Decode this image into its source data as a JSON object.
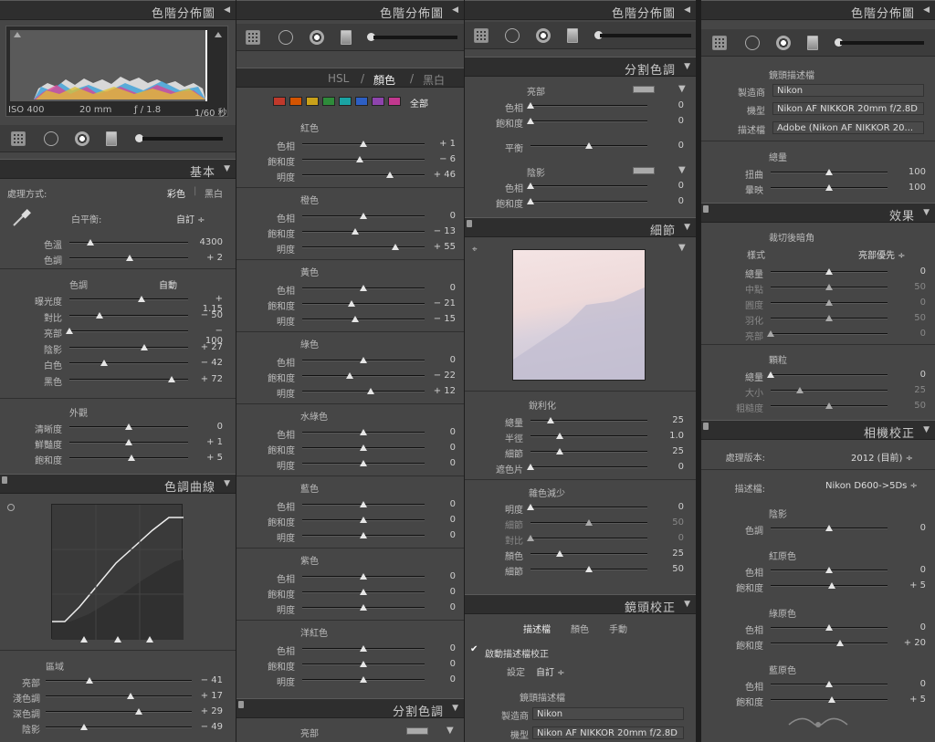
{
  "colors": {
    "panel": "#464646",
    "header": "#2e2e2e"
  },
  "c1": {
    "histogram_title": "色階分佈圖",
    "hist_info": {
      "iso": "ISO 400",
      "focal": "20 mm",
      "aperture": "ƒ / 1.8",
      "shutter": "1/60 秒"
    },
    "basic_title": "基本",
    "treatment_label": "處理方式:",
    "color_label": "彩色",
    "bw_label": "黑白",
    "wb_label": "白平衡:",
    "wb_value": "自訂 ÷",
    "temp": {
      "label": "色溫",
      "value": "4300",
      "pos": 0.18
    },
    "tint": {
      "label": "色調",
      "value": "+ 2",
      "pos": 0.51
    },
    "tone_label": "色調",
    "auto_label": "自動",
    "tone": [
      {
        "label": "曝光度",
        "value": "+ 1.15",
        "pos": 0.61
      },
      {
        "label": "對比",
        "value": "− 50",
        "pos": 0.25
      },
      {
        "label": "亮部",
        "value": "− 100",
        "pos": 0.0
      },
      {
        "label": "陰影",
        "value": "+ 27",
        "pos": 0.63
      },
      {
        "label": "白色",
        "value": "− 42",
        "pos": 0.29
      },
      {
        "label": "黑色",
        "value": "+ 72",
        "pos": 0.86
      }
    ],
    "presence_label": "外觀",
    "presence": [
      {
        "label": "清晰度",
        "value": "0",
        "pos": 0.5
      },
      {
        "label": "鮮豔度",
        "value": "+ 1",
        "pos": 0.5
      },
      {
        "label": "飽和度",
        "value": "+ 5",
        "pos": 0.52
      }
    ],
    "curve_title": "色調曲線",
    "region_label": "區域",
    "region": [
      {
        "label": "亮部",
        "value": "− 41",
        "pos": 0.3
      },
      {
        "label": "淺色調",
        "value": "+ 17",
        "pos": 0.58
      },
      {
        "label": "深色調",
        "value": "+ 29",
        "pos": 0.64
      },
      {
        "label": "陰影",
        "value": "− 49",
        "pos": 0.26
      }
    ]
  },
  "c2": {
    "histogram_title": "色階分佈圖",
    "hsl_tabs": {
      "hsl": "HSL",
      "slash1": "/",
      "color": "顏色",
      "slash2": "/",
      "bw": "黑白"
    },
    "all_label": "全部",
    "swatches": [
      "#c0392b",
      "#d35400",
      "#c9a11a",
      "#2e8b3a",
      "#1aa3a3",
      "#2d5fc4",
      "#8e44ad",
      "#c2388f"
    ],
    "groups": [
      {
        "name": "紅色",
        "rows": [
          {
            "label": "色相",
            "value": "+ 1",
            "pos": 0.5
          },
          {
            "label": "飽和度",
            "value": "− 6",
            "pos": 0.47
          },
          {
            "label": "明度",
            "value": "+ 46",
            "pos": 0.72
          }
        ],
        "grad": [
          "#c83c3c",
          "#d8a040"
        ]
      },
      {
        "name": "橙色",
        "rows": [
          {
            "label": "色相",
            "value": "0",
            "pos": 0.5
          },
          {
            "label": "飽和度",
            "value": "− 13",
            "pos": 0.43
          },
          {
            "label": "明度",
            "value": "+ 55",
            "pos": 0.76
          }
        ],
        "grad": [
          "#d0603a",
          "#d8c040"
        ]
      },
      {
        "name": "黃色",
        "rows": [
          {
            "label": "色相",
            "value": "0",
            "pos": 0.5
          },
          {
            "label": "飽和度",
            "value": "− 21",
            "pos": 0.4
          },
          {
            "label": "明度",
            "value": "− 15",
            "pos": 0.43
          }
        ],
        "grad": [
          "#d0a030",
          "#90c040"
        ]
      },
      {
        "name": "綠色",
        "rows": [
          {
            "label": "色相",
            "value": "0",
            "pos": 0.5
          },
          {
            "label": "飽和度",
            "value": "− 22",
            "pos": 0.39
          },
          {
            "label": "明度",
            "value": "+ 12",
            "pos": 0.56
          }
        ],
        "grad": [
          "#a0c040",
          "#30b080"
        ]
      },
      {
        "name": "水綠色",
        "rows": [
          {
            "label": "色相",
            "value": "0",
            "pos": 0.5
          },
          {
            "label": "飽和度",
            "value": "0",
            "pos": 0.5
          },
          {
            "label": "明度",
            "value": "0",
            "pos": 0.5
          }
        ],
        "grad": [
          "#30b080",
          "#3080c8"
        ]
      },
      {
        "name": "藍色",
        "rows": [
          {
            "label": "色相",
            "value": "0",
            "pos": 0.5
          },
          {
            "label": "飽和度",
            "value": "0",
            "pos": 0.5
          },
          {
            "label": "明度",
            "value": "0",
            "pos": 0.5
          }
        ],
        "grad": [
          "#30a0c8",
          "#5050c8"
        ]
      },
      {
        "name": "紫色",
        "rows": [
          {
            "label": "色相",
            "value": "0",
            "pos": 0.5
          },
          {
            "label": "飽和度",
            "value": "0",
            "pos": 0.5
          },
          {
            "label": "明度",
            "value": "0",
            "pos": 0.5
          }
        ],
        "grad": [
          "#5050c8",
          "#b040b0"
        ]
      },
      {
        "name": "洋紅色",
        "rows": [
          {
            "label": "色相",
            "value": "0",
            "pos": 0.5
          },
          {
            "label": "飽和度",
            "value": "0",
            "pos": 0.5
          },
          {
            "label": "明度",
            "value": "0",
            "pos": 0.5
          }
        ],
        "grad": [
          "#b040b0",
          "#c83c6c"
        ]
      }
    ],
    "split_title": "分割色調",
    "highlights_label": "亮部"
  },
  "c3": {
    "histogram_title": "色階分佈圖",
    "split_title": "分割色調",
    "highlights_label": "亮部",
    "hl_rows": [
      {
        "label": "色相",
        "value": "0",
        "pos": 0.0
      },
      {
        "label": "飽和度",
        "value": "0",
        "pos": 0.0
      }
    ],
    "balance": {
      "label": "平衡",
      "value": "0",
      "pos": 0.5
    },
    "shadows_label": "陰影",
    "sh_rows": [
      {
        "label": "色相",
        "value": "0",
        "pos": 0.0
      },
      {
        "label": "飽和度",
        "value": "0",
        "pos": 0.0
      }
    ],
    "detail_title": "細節",
    "sharpen_label": "銳利化",
    "sharpen": [
      {
        "label": "總量",
        "value": "25",
        "pos": 0.17
      },
      {
        "label": "半徑",
        "value": "1.0",
        "pos": 0.25
      },
      {
        "label": "細節",
        "value": "25",
        "pos": 0.25
      },
      {
        "label": "遮色片",
        "value": "0",
        "pos": 0.0
      }
    ],
    "nr_label": "雜色減少",
    "nr": [
      {
        "label": "明度",
        "value": "0",
        "pos": 0.0
      },
      {
        "label": "細節",
        "value": "50",
        "pos": 0.5,
        "dim": true
      },
      {
        "label": "對比",
        "value": "0",
        "pos": 0.0,
        "dim": true
      },
      {
        "label": "顏色",
        "value": "25",
        "pos": 0.25
      },
      {
        "label": "細節",
        "value": "50",
        "pos": 0.5
      }
    ],
    "lens_title": "鏡頭校正",
    "lens_tabs": [
      "描述檔",
      "顏色",
      "手動"
    ],
    "enable_label": "啟動描述檔校正",
    "setup_label": "設定",
    "setup_value": "自訂 ÷",
    "lens_profile_label": "鏡頭描述檔",
    "make_label": "製造商",
    "make_value": "Nikon",
    "model_label": "機型",
    "model_value": "Nikon AF NIKKOR 20mm f/2.8D"
  },
  "c4": {
    "histogram_title": "色階分佈圖",
    "lens_profile_label": "鏡頭描述檔",
    "make_label": "製造商",
    "make_value": "Nikon",
    "model_label": "機型",
    "model_value": "Nikon AF NIKKOR 20mm f/2.8D",
    "profile_label": "描述檔",
    "profile_value": "Adobe (Nikon AF NIKKOR 20...",
    "amount_label": "總量",
    "amount": [
      {
        "label": "扭曲",
        "value": "100",
        "pos": 0.5
      },
      {
        "label": "暈映",
        "value": "100",
        "pos": 0.5
      }
    ],
    "effects_title": "效果",
    "vignette_label": "裁切後暗角",
    "style_label": "樣式",
    "style_value": "亮部優先 ÷",
    "vignette": [
      {
        "label": "總量",
        "value": "0",
        "pos": 0.5
      },
      {
        "label": "中點",
        "value": "50",
        "pos": 0.5,
        "dim": true
      },
      {
        "label": "圓度",
        "value": "0",
        "pos": 0.5,
        "dim": true
      },
      {
        "label": "羽化",
        "value": "50",
        "pos": 0.5,
        "dim": true
      },
      {
        "label": "亮部",
        "value": "0",
        "pos": 0.0,
        "dim": true
      }
    ],
    "grain_label": "顆粒",
    "grain": [
      {
        "label": "總量",
        "value": "0",
        "pos": 0.0
      },
      {
        "label": "大小",
        "value": "25",
        "pos": 0.25,
        "dim": true
      },
      {
        "label": "粗糙度",
        "value": "50",
        "pos": 0.5,
        "dim": true
      }
    ],
    "camera_title": "相機校正",
    "process_label": "處理版本:",
    "process_value": "2012 (目前) ÷",
    "cprofile_label": "描述檔:",
    "cprofile_value": "Nikon D600->5Ds ÷",
    "shadows_label": "陰影",
    "sh_tint": {
      "label": "色調",
      "value": "0",
      "pos": 0.5
    },
    "red_label": "紅原色",
    "red": [
      {
        "label": "色相",
        "value": "0",
        "pos": 0.5
      },
      {
        "label": "飽和度",
        "value": "+ 5",
        "pos": 0.52
      }
    ],
    "green_label": "綠原色",
    "green": [
      {
        "label": "色相",
        "value": "0",
        "pos": 0.5
      },
      {
        "label": "飽和度",
        "value": "+ 20",
        "pos": 0.59
      }
    ],
    "blue_label": "藍原色",
    "blue": [
      {
        "label": "色相",
        "value": "0",
        "pos": 0.5
      },
      {
        "label": "飽和度",
        "value": "+ 5",
        "pos": 0.52
      }
    ]
  }
}
